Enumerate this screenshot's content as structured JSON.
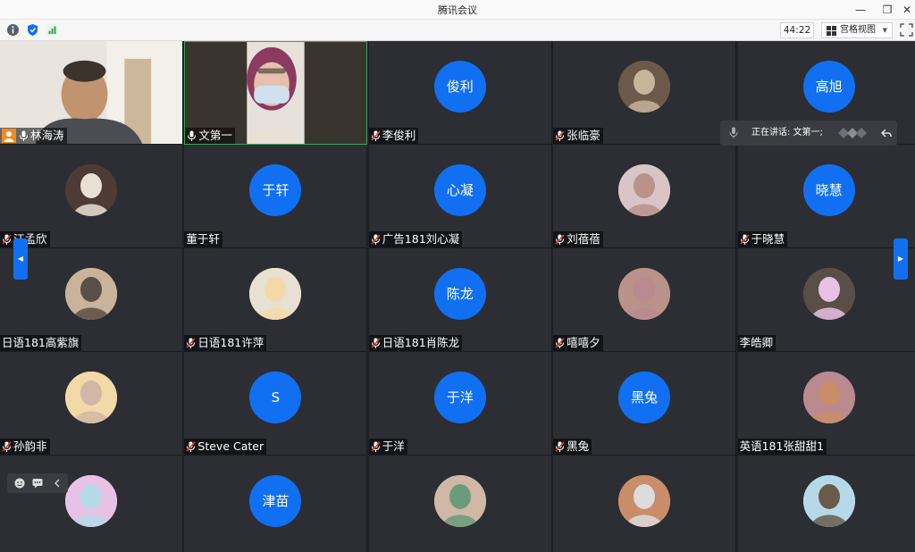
{
  "window": {
    "title": "腾讯会议",
    "controls": [
      "—",
      "❐",
      "✕"
    ]
  },
  "toolbar": {
    "timer": "44:22",
    "view_label": "宫格视图",
    "accent": "#1170f2"
  },
  "speaking": {
    "text": "正在讲话: 文第一;"
  },
  "participants": [
    {
      "name": "林海涛",
      "kind": "video",
      "mic": "on",
      "host": true
    },
    {
      "name": "文第一",
      "kind": "video",
      "mic": "on",
      "active": true
    },
    {
      "name": "李俊利",
      "avatar_text": "俊利",
      "kind": "initials",
      "mic": "off"
    },
    {
      "name": "张临豪",
      "kind": "photo",
      "mic": "off"
    },
    {
      "name": "",
      "avatar_text": "高旭",
      "kind": "initials",
      "mic": "none"
    },
    {
      "name": "汪孟欣",
      "kind": "photo",
      "mic": "off"
    },
    {
      "name": "董于轩",
      "avatar_text": "于轩",
      "kind": "initials",
      "mic": "none"
    },
    {
      "name": "广告181刘心凝",
      "avatar_text": "心凝",
      "kind": "initials",
      "mic": "off"
    },
    {
      "name": "刘蓓蓓",
      "kind": "photo",
      "mic": "off"
    },
    {
      "name": "于晓慧",
      "avatar_text": "晓慧",
      "kind": "initials",
      "mic": "off"
    },
    {
      "name": "日语181高紫旗",
      "kind": "photo",
      "mic": "none"
    },
    {
      "name": "日语181许萍",
      "kind": "photo",
      "mic": "off"
    },
    {
      "name": "日语181肖陈龙",
      "avatar_text": "陈龙",
      "kind": "initials",
      "mic": "off"
    },
    {
      "name": "嘻嘻夕",
      "kind": "photo",
      "mic": "off"
    },
    {
      "name": "李皓卿",
      "kind": "photo",
      "mic": "none"
    },
    {
      "name": "孙韵非",
      "kind": "photo",
      "mic": "off"
    },
    {
      "name": "Steve Cater",
      "avatar_text": "S",
      "kind": "initials",
      "mic": "off"
    },
    {
      "name": "于洋",
      "avatar_text": "于洋",
      "kind": "initials",
      "mic": "off"
    },
    {
      "name": "黑兔",
      "avatar_text": "黑兔",
      "kind": "initials",
      "mic": "off"
    },
    {
      "name": "英语181张甜甜1",
      "kind": "photo",
      "mic": "none"
    },
    {
      "name": "",
      "kind": "photo",
      "mic": "none"
    },
    {
      "name": "",
      "avatar_text": "津苗",
      "kind": "initials",
      "mic": "none"
    },
    {
      "name": "",
      "kind": "photo",
      "mic": "none"
    },
    {
      "name": "",
      "kind": "photo",
      "mic": "none"
    },
    {
      "name": "",
      "kind": "photo",
      "mic": "none"
    }
  ],
  "photo_colors": [
    "#6b5a4a",
    "#4f3b35",
    "#d9c4c8",
    "#c9b39a",
    "#e8e0d2",
    "#b9928a",
    "#5a4e48",
    "#f3d9a8",
    "#b98a8f",
    "#e7c2e6",
    "#d0b7a6",
    "#c98d6a",
    "#b5d9e8",
    "#6a9c7a",
    "#dcdcdc"
  ]
}
